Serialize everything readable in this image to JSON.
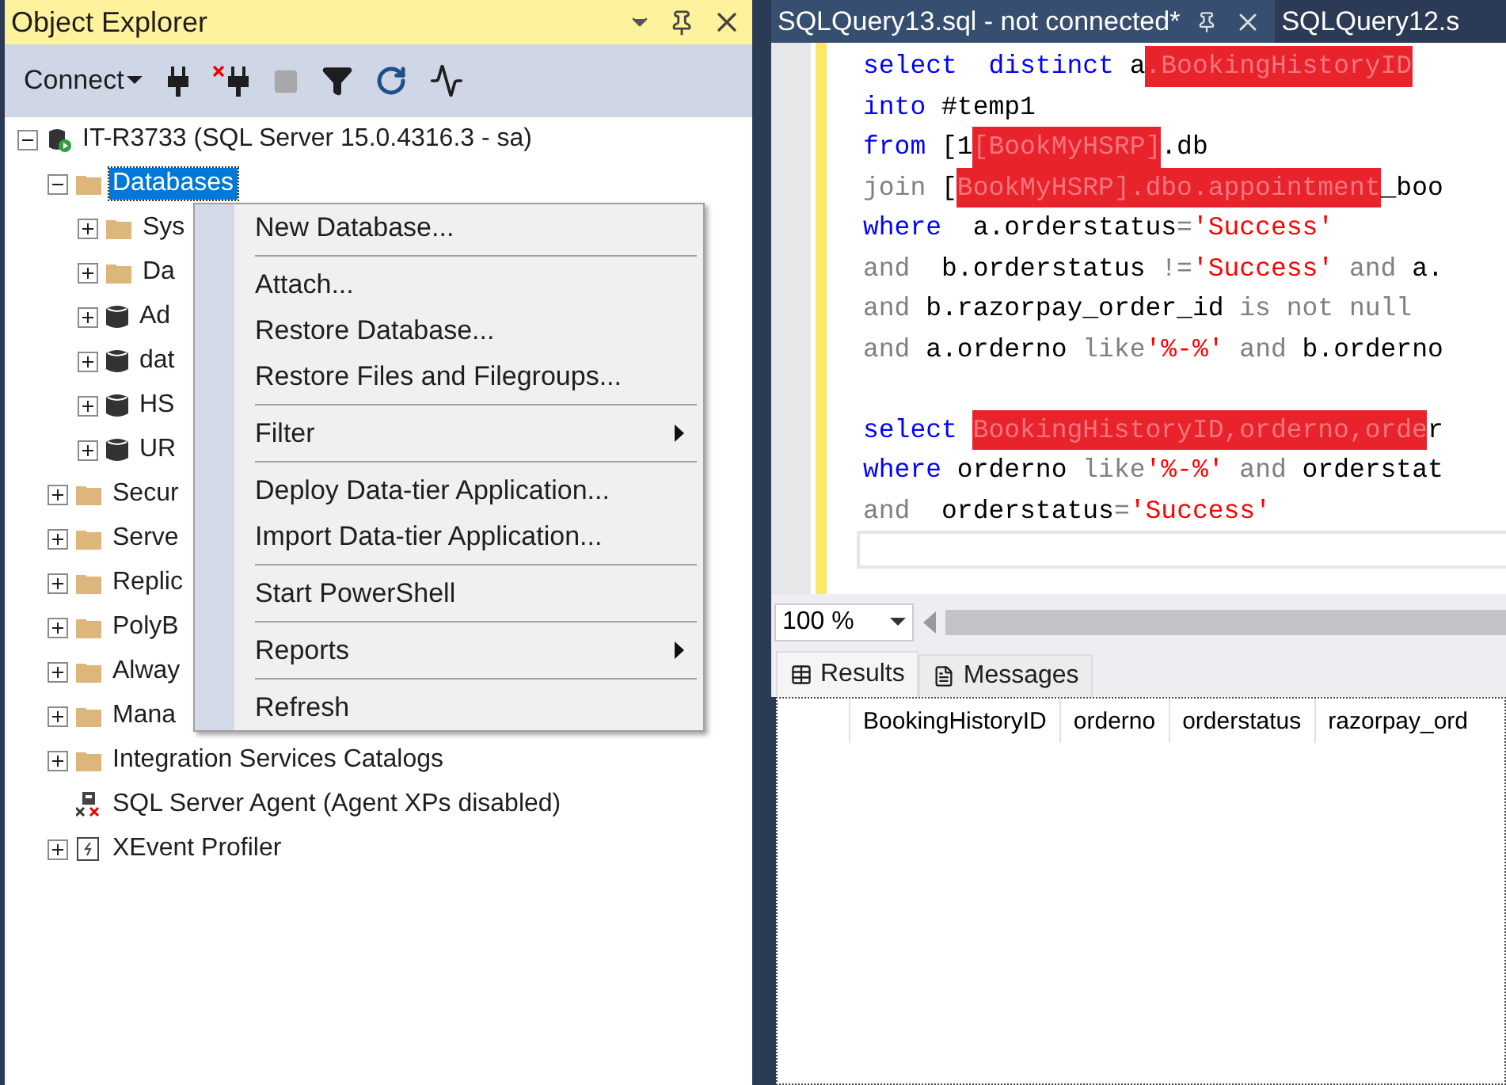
{
  "object_explorer": {
    "title": "Object Explorer",
    "toolbar": {
      "connect_label": "Connect"
    },
    "tree": [
      {
        "label": "IT-R3733 (SQL Server 15.0.4316.3 - sa)",
        "kind": "server",
        "expanded": true,
        "selected": false,
        "children": [
          {
            "label": "Databases",
            "kind": "folder",
            "expanded": true,
            "selected": true,
            "children": [
              {
                "label": "Sys",
                "kind": "folder",
                "expanded": false,
                "selected": false
              },
              {
                "label": "Da",
                "kind": "folder",
                "expanded": false,
                "selected": false
              },
              {
                "label": "Ad",
                "kind": "database",
                "expanded": false,
                "selected": false
              },
              {
                "label": "dat",
                "kind": "database",
                "expanded": false,
                "selected": false
              },
              {
                "label": "HS",
                "kind": "database",
                "expanded": false,
                "selected": false
              },
              {
                "label": "UR",
                "kind": "database",
                "expanded": false,
                "selected": false
              }
            ]
          },
          {
            "label": "Secur",
            "kind": "folder",
            "expanded": false,
            "selected": false
          },
          {
            "label": "Serve",
            "kind": "folder",
            "expanded": false,
            "selected": false
          },
          {
            "label": "Replic",
            "kind": "folder",
            "expanded": false,
            "selected": false
          },
          {
            "label": "PolyB",
            "kind": "folder",
            "expanded": false,
            "selected": false
          },
          {
            "label": "Alway",
            "kind": "folder",
            "expanded": false,
            "selected": false
          },
          {
            "label": "Mana",
            "kind": "folder",
            "expanded": false,
            "selected": false
          },
          {
            "label": "Integration Services Catalogs",
            "kind": "folder",
            "expanded": false,
            "selected": false
          },
          {
            "label": "SQL Server Agent (Agent XPs disabled)",
            "kind": "agent",
            "selected": false
          },
          {
            "label": "XEvent Profiler",
            "kind": "profiler",
            "expanded": false,
            "selected": false
          }
        ]
      }
    ],
    "context_menu": {
      "groups": [
        [
          {
            "label": "New Database...",
            "submenu": false
          }
        ],
        [
          {
            "label": "Attach...",
            "submenu": false
          },
          {
            "label": "Restore Database...",
            "submenu": false
          },
          {
            "label": "Restore Files and Filegroups...",
            "submenu": false
          }
        ],
        [
          {
            "label": "Filter",
            "submenu": true
          }
        ],
        [
          {
            "label": "Deploy Data-tier Application...",
            "submenu": false
          },
          {
            "label": "Import Data-tier Application...",
            "submenu": false
          }
        ],
        [
          {
            "label": "Start PowerShell",
            "submenu": false
          }
        ],
        [
          {
            "label": "Reports",
            "submenu": true
          }
        ],
        [
          {
            "label": "Refresh",
            "submenu": false
          }
        ]
      ]
    }
  },
  "editor": {
    "tabs": [
      {
        "label": "SQLQuery13.sql - not connected*",
        "selected": true
      },
      {
        "label": "SQLQuery12.s",
        "selected": false
      }
    ],
    "lines": [
      {
        "kind": "code",
        "tokens": [
          {
            "kind": "keyword",
            "text": "select  distinct"
          },
          {
            "kind": "plain",
            "text": " a"
          },
          {
            "kind": "redacted",
            "text": ".BookingHistoryID"
          }
        ]
      },
      {
        "kind": "code",
        "tokens": [
          {
            "kind": "keyword",
            "text": "into"
          },
          {
            "kind": "plain",
            "text": " #temp1"
          }
        ]
      },
      {
        "kind": "code",
        "tokens": [
          {
            "kind": "keyword",
            "text": "from"
          },
          {
            "kind": "plain",
            "text": " [1"
          },
          {
            "kind": "redacted",
            "text": "[BookMyHSRP]"
          },
          {
            "kind": "plain",
            "text": ".db"
          }
        ]
      },
      {
        "kind": "code",
        "tokens": [
          {
            "kind": "operator",
            "text": "join"
          },
          {
            "kind": "plain",
            "text": " ["
          },
          {
            "kind": "redacted",
            "text": "BookMyHSRP].dbo.appointment"
          },
          {
            "kind": "plain",
            "text": "_boo"
          }
        ]
      },
      {
        "kind": "code",
        "tokens": [
          {
            "kind": "keyword",
            "text": "where"
          },
          {
            "kind": "plain",
            "text": "  a.orderstatus"
          },
          {
            "kind": "operator",
            "text": "="
          },
          {
            "kind": "string",
            "text": "'Success'"
          }
        ]
      },
      {
        "kind": "code",
        "tokens": [
          {
            "kind": "operator",
            "text": "and"
          },
          {
            "kind": "plain",
            "text": "  b.orderstatus "
          },
          {
            "kind": "operator",
            "text": "!="
          },
          {
            "kind": "string",
            "text": "'Success'"
          },
          {
            "kind": "operator",
            "text": " and"
          },
          {
            "kind": "plain",
            "text": " a."
          }
        ]
      },
      {
        "kind": "code",
        "tokens": [
          {
            "kind": "operator",
            "text": "and"
          },
          {
            "kind": "plain",
            "text": " b.razorpay_order_id "
          },
          {
            "kind": "operator",
            "text": "is not null"
          }
        ]
      },
      {
        "kind": "code",
        "tokens": [
          {
            "kind": "operator",
            "text": "and"
          },
          {
            "kind": "plain",
            "text": " a.orderno "
          },
          {
            "kind": "operator",
            "text": "like"
          },
          {
            "kind": "string",
            "text": "'%-%'"
          },
          {
            "kind": "operator",
            "text": " and"
          },
          {
            "kind": "plain",
            "text": " b.orderno"
          }
        ]
      },
      {
        "kind": "blank"
      },
      {
        "kind": "code",
        "tokens": [
          {
            "kind": "keyword",
            "text": "select "
          },
          {
            "kind": "redacted",
            "text": "BookingHistoryID,orderno,orde"
          },
          {
            "kind": "plain",
            "text": "r"
          }
        ]
      },
      {
        "kind": "code",
        "tokens": [
          {
            "kind": "keyword",
            "text": "where"
          },
          {
            "kind": "plain",
            "text": " orderno "
          },
          {
            "kind": "operator",
            "text": "like"
          },
          {
            "kind": "string",
            "text": "'%-%'"
          },
          {
            "kind": "operator",
            "text": " and"
          },
          {
            "kind": "plain",
            "text": " orderstat"
          }
        ]
      },
      {
        "kind": "code",
        "tokens": [
          {
            "kind": "operator",
            "text": "and"
          },
          {
            "kind": "plain",
            "text": "  orderstatus"
          },
          {
            "kind": "operator",
            "text": "="
          },
          {
            "kind": "string",
            "text": "'Success'"
          }
        ]
      },
      {
        "kind": "cursor"
      }
    ],
    "zoom": "100 %"
  },
  "results": {
    "tabs": [
      {
        "label": "Results",
        "kind": "grid",
        "selected": true
      },
      {
        "label": "Messages",
        "kind": "messages",
        "selected": false
      }
    ],
    "columns": [
      "BookingHistoryID",
      "orderno",
      "orderstatus",
      "razorpay_ord"
    ]
  }
}
